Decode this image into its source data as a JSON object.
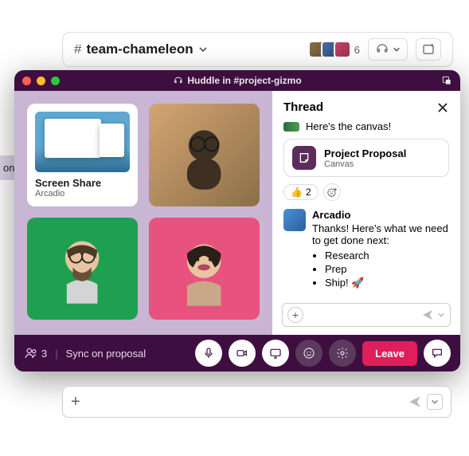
{
  "channel": {
    "name": "team-chameleon",
    "member_count": "6"
  },
  "sidebar_hint": "on",
  "huddle": {
    "title": "Huddle in #project-gizmo",
    "share_tile": {
      "label": "Screen Share",
      "sub": "Arcadio"
    },
    "footer": {
      "participant_count": "3",
      "topic": "Sync on proposal",
      "leave": "Leave"
    }
  },
  "thread": {
    "title": "Thread",
    "msg1": "Here's the canvas!",
    "canvas": {
      "title": "Project Proposal",
      "sub": "Canvas"
    },
    "reaction_count": "2",
    "msg2": {
      "name": "Arcadio",
      "body": "Thanks! Here's what we need to get done next:",
      "items": [
        "Research",
        "Prep",
        "Ship! 🚀"
      ]
    }
  }
}
